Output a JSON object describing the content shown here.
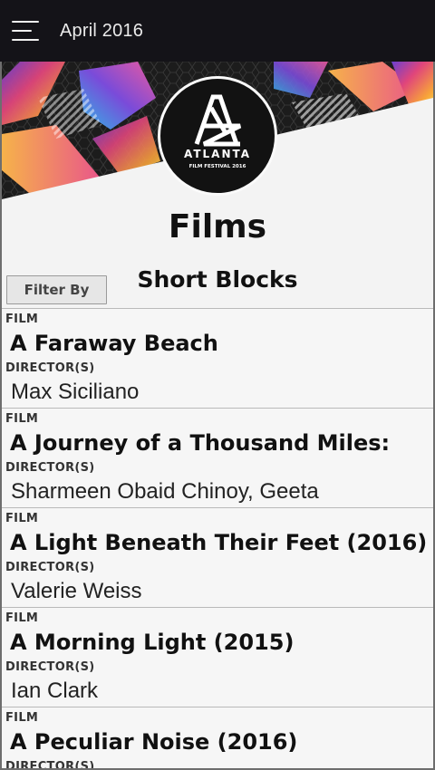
{
  "header": {
    "menu_icon": "hamburger-menu-icon",
    "title": "April 2016"
  },
  "banner": {
    "logo": {
      "name": "ATLANTA",
      "subtitle": "FILM FESTIVAL 2016"
    }
  },
  "page": {
    "title": "Films",
    "section": "Short Blocks",
    "filter_label": "Filter By"
  },
  "films": [
    {
      "label": "FILM",
      "title": "A Faraway Beach",
      "director_label": "DIRECTOR(S)",
      "director": "Max Siciliano"
    },
    {
      "label": "FILM",
      "title": "A Journey of a Thousand Miles:",
      "director_label": "DIRECTOR(S)",
      "director": "Sharmeen Obaid Chinoy, Geeta"
    },
    {
      "label": "FILM",
      "title": "A Light Beneath Their Feet (2016)",
      "director_label": "DIRECTOR(S)",
      "director": "Valerie Weiss"
    },
    {
      "label": "FILM",
      "title": "A Morning Light (2015)",
      "director_label": "DIRECTOR(S)",
      "director": "Ian Clark"
    },
    {
      "label": "FILM",
      "title": "A Peculiar Noise (2016)",
      "director_label": "DIRECTOR(S)",
      "director": ""
    }
  ]
}
